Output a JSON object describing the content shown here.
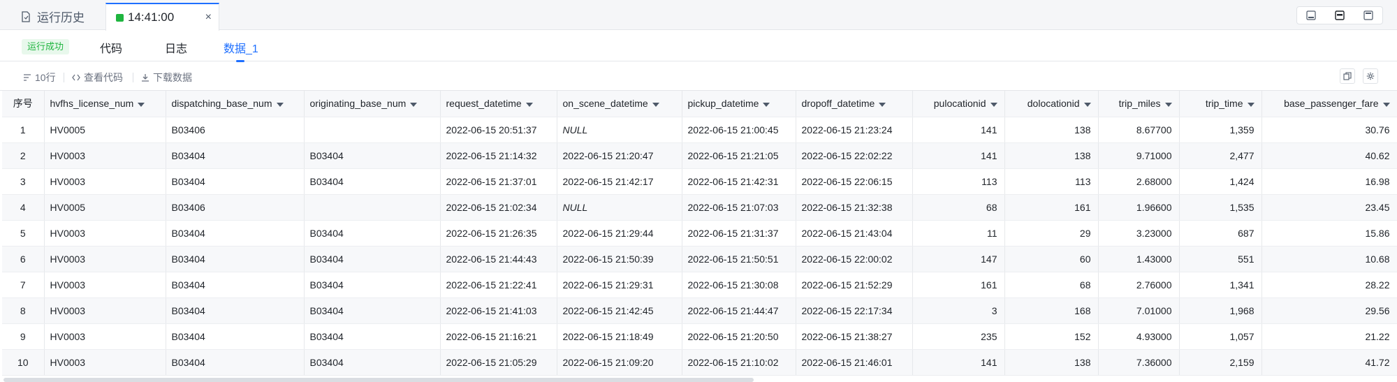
{
  "tabs": {
    "history": "运行历史",
    "run": "14:41:00",
    "close": "×"
  },
  "status_badge": "运行成功",
  "subtabs": [
    "代码",
    "日志",
    "数据_1"
  ],
  "toolbar": {
    "rows": "10行",
    "view_code": "查看代码",
    "download": "下载数据"
  },
  "table": {
    "columns": [
      "序号",
      "hvfhs_license_num",
      "dispatching_base_num",
      "originating_base_num",
      "request_datetime",
      "on_scene_datetime",
      "pickup_datetime",
      "dropoff_datetime",
      "pulocationid",
      "dolocationid",
      "trip_miles",
      "trip_time",
      "base_passenger_fare"
    ],
    "rows": [
      [
        "1",
        "HV0005",
        "B03406",
        "",
        "2022-06-15 20:51:37",
        "NULL",
        "2022-06-15 21:00:45",
        "2022-06-15 21:23:24",
        "141",
        "138",
        "8.67700",
        "1,359",
        "30.76"
      ],
      [
        "2",
        "HV0003",
        "B03404",
        "B03404",
        "2022-06-15 21:14:32",
        "2022-06-15 21:20:47",
        "2022-06-15 21:21:05",
        "2022-06-15 22:02:22",
        "141",
        "138",
        "9.71000",
        "2,477",
        "40.62"
      ],
      [
        "3",
        "HV0003",
        "B03404",
        "B03404",
        "2022-06-15 21:37:01",
        "2022-06-15 21:42:17",
        "2022-06-15 21:42:31",
        "2022-06-15 22:06:15",
        "113",
        "113",
        "2.68000",
        "1,424",
        "16.98"
      ],
      [
        "4",
        "HV0005",
        "B03406",
        "",
        "2022-06-15 21:02:34",
        "NULL",
        "2022-06-15 21:07:03",
        "2022-06-15 21:32:38",
        "68",
        "161",
        "1.96600",
        "1,535",
        "23.45"
      ],
      [
        "5",
        "HV0003",
        "B03404",
        "B03404",
        "2022-06-15 21:26:35",
        "2022-06-15 21:29:44",
        "2022-06-15 21:31:37",
        "2022-06-15 21:43:04",
        "11",
        "29",
        "3.23000",
        "687",
        "15.86"
      ],
      [
        "6",
        "HV0003",
        "B03404",
        "B03404",
        "2022-06-15 21:44:43",
        "2022-06-15 21:50:39",
        "2022-06-15 21:50:51",
        "2022-06-15 22:00:02",
        "147",
        "60",
        "1.43000",
        "551",
        "10.68"
      ],
      [
        "7",
        "HV0003",
        "B03404",
        "B03404",
        "2022-06-15 21:22:41",
        "2022-06-15 21:29:31",
        "2022-06-15 21:30:08",
        "2022-06-15 21:52:29",
        "161",
        "68",
        "2.76000",
        "1,341",
        "28.22"
      ],
      [
        "8",
        "HV0003",
        "B03404",
        "B03404",
        "2022-06-15 21:41:03",
        "2022-06-15 21:42:45",
        "2022-06-15 21:44:47",
        "2022-06-15 22:17:34",
        "3",
        "168",
        "7.01000",
        "1,968",
        "29.56"
      ],
      [
        "9",
        "HV0003",
        "B03404",
        "B03404",
        "2022-06-15 21:16:21",
        "2022-06-15 21:18:49",
        "2022-06-15 21:20:50",
        "2022-06-15 21:38:27",
        "235",
        "152",
        "4.93000",
        "1,057",
        "21.22"
      ],
      [
        "10",
        "HV0003",
        "B03404",
        "B03404",
        "2022-06-15 21:05:29",
        "2022-06-15 21:09:20",
        "2022-06-15 21:10:02",
        "2022-06-15 21:46:01",
        "141",
        "138",
        "7.36000",
        "2,159",
        "41.72"
      ]
    ]
  },
  "colors": {
    "accent": "#1e6fff",
    "success": "#1fb53f",
    "success_bg": "#e8f8ec"
  }
}
